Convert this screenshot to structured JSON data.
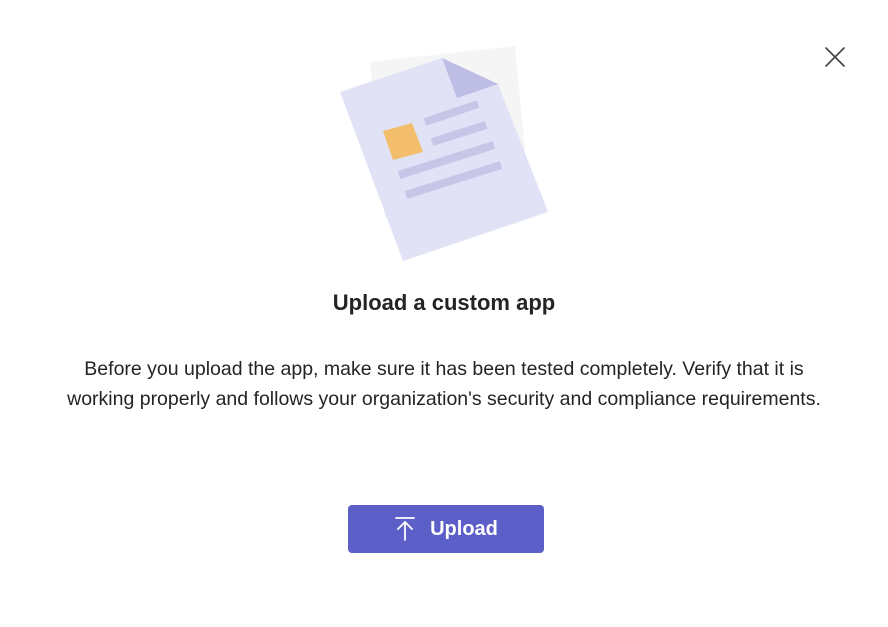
{
  "dialog": {
    "title": "Upload a custom app",
    "description": "Before you upload the app, make sure it has been tested completely. Verify that it is working properly and follows your organization's security and compliance requirements.",
    "close_icon": "close-icon",
    "illustration_icon": "document-icon"
  },
  "upload_button": {
    "label": "Upload",
    "icon": "arrow-up-to-line-icon"
  },
  "colors": {
    "accent": "#5b5fc7",
    "text": "#242424",
    "background": "#ffffff",
    "illustration_page": "#e1e2f6",
    "illustration_back": "#f5f5f5",
    "illustration_lines": "#c5c6e8",
    "illustration_fold": "#bdbde6",
    "illustration_square": "#f2be6b"
  }
}
